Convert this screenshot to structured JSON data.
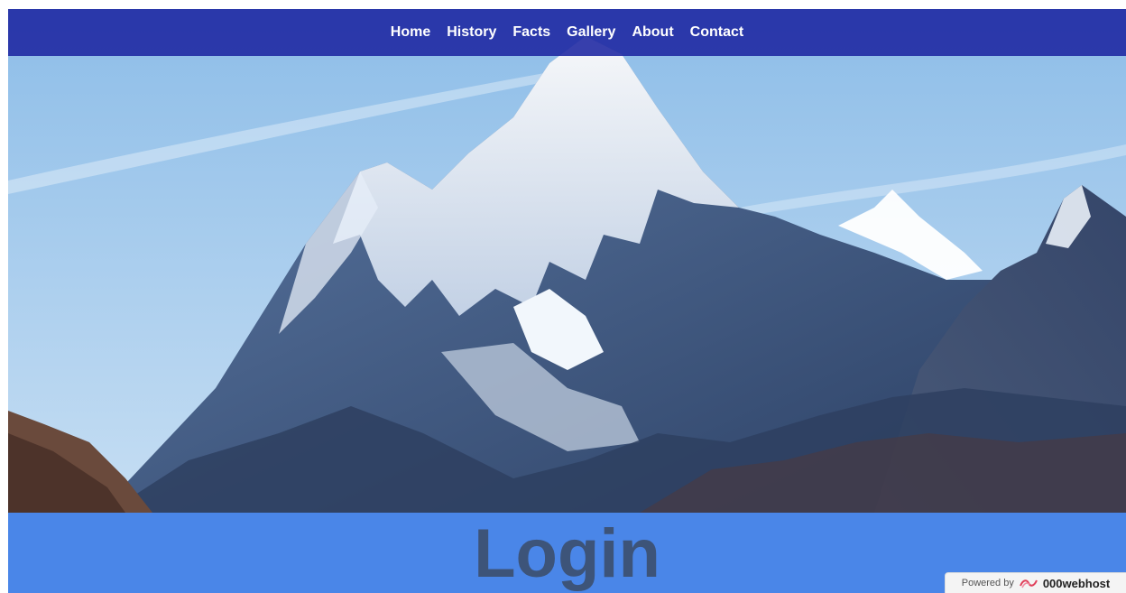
{
  "nav": {
    "items": [
      {
        "label": "Home"
      },
      {
        "label": "History"
      },
      {
        "label": "Facts"
      },
      {
        "label": "Gallery"
      },
      {
        "label": "About"
      },
      {
        "label": "Contact"
      }
    ]
  },
  "hero": {
    "image_subject": "snow-capped mountain peak under blue sky"
  },
  "login": {
    "heading": "Login"
  },
  "badge": {
    "powered_by": "Powered by",
    "brand": "000webhost",
    "icon": "webhost-logo-icon"
  },
  "colors": {
    "nav_bg": "#1c26a0",
    "band_bg": "#4a86e8",
    "heading": "#3d5479",
    "sky": "#a9cdee"
  }
}
